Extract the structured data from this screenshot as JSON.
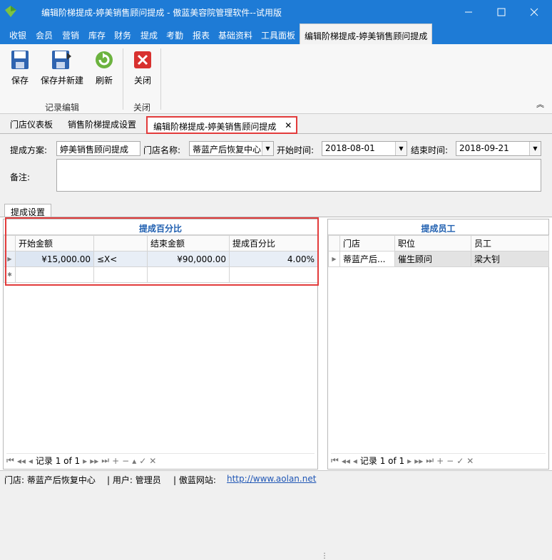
{
  "window": {
    "title": "编辑阶梯提成-婷美销售顾问提成 - 傲蓝美容院管理软件--试用版"
  },
  "menu": {
    "items": [
      "收银",
      "会员",
      "营销",
      "库存",
      "财务",
      "提成",
      "考勤",
      "报表",
      "基础资料",
      "工具面板"
    ],
    "active": "编辑阶梯提成-婷美销售顾问提成"
  },
  "ribbon": {
    "save": "保存",
    "save_new": "保存并新建",
    "refresh": "刷新",
    "close": "关闭",
    "group_record": "记录编辑",
    "group_close": "关闭"
  },
  "doc_tabs": [
    "门店仪表板",
    "销售阶梯提成设置",
    "编辑阶梯提成-婷美销售顾问提成"
  ],
  "form": {
    "scheme_label": "提成方案:",
    "scheme_value": "婷美销售顾问提成",
    "store_label": "门店名称:",
    "store_value": "蒂蓝产后恢复中心",
    "start_label": "开始时间:",
    "start_value": "2018-08-01",
    "end_label": "结束时间:",
    "end_value": "2018-09-21",
    "note_label": "备注:",
    "note_value": ""
  },
  "inner_tab": "提成设置",
  "percent_panel": {
    "title": "提成百分比",
    "columns": [
      "开始金额",
      "",
      "结束金额",
      "提成百分比"
    ],
    "rows": [
      [
        "¥15,000.00",
        "≤X<",
        "¥90,000.00",
        "4.00%"
      ]
    ],
    "nav": "记录 1 of 1"
  },
  "staff_panel": {
    "title": "提成员工",
    "columns": [
      "门店",
      "职位",
      "员工"
    ],
    "rows": [
      [
        "蒂蓝产后...",
        "催生顾问",
        "梁大钊"
      ]
    ],
    "nav": "记录 1 of 1"
  },
  "status": {
    "store": "门店: 蒂蓝产后恢复中心",
    "user": "| 用户: 管理员",
    "site_label": "| 傲蓝网站:",
    "site_url": "http://www.aolan.net"
  },
  "colors": {
    "titlebar": "#1e7bd6",
    "accent": "#1f5fb0",
    "highlight": "#e23b3b"
  }
}
